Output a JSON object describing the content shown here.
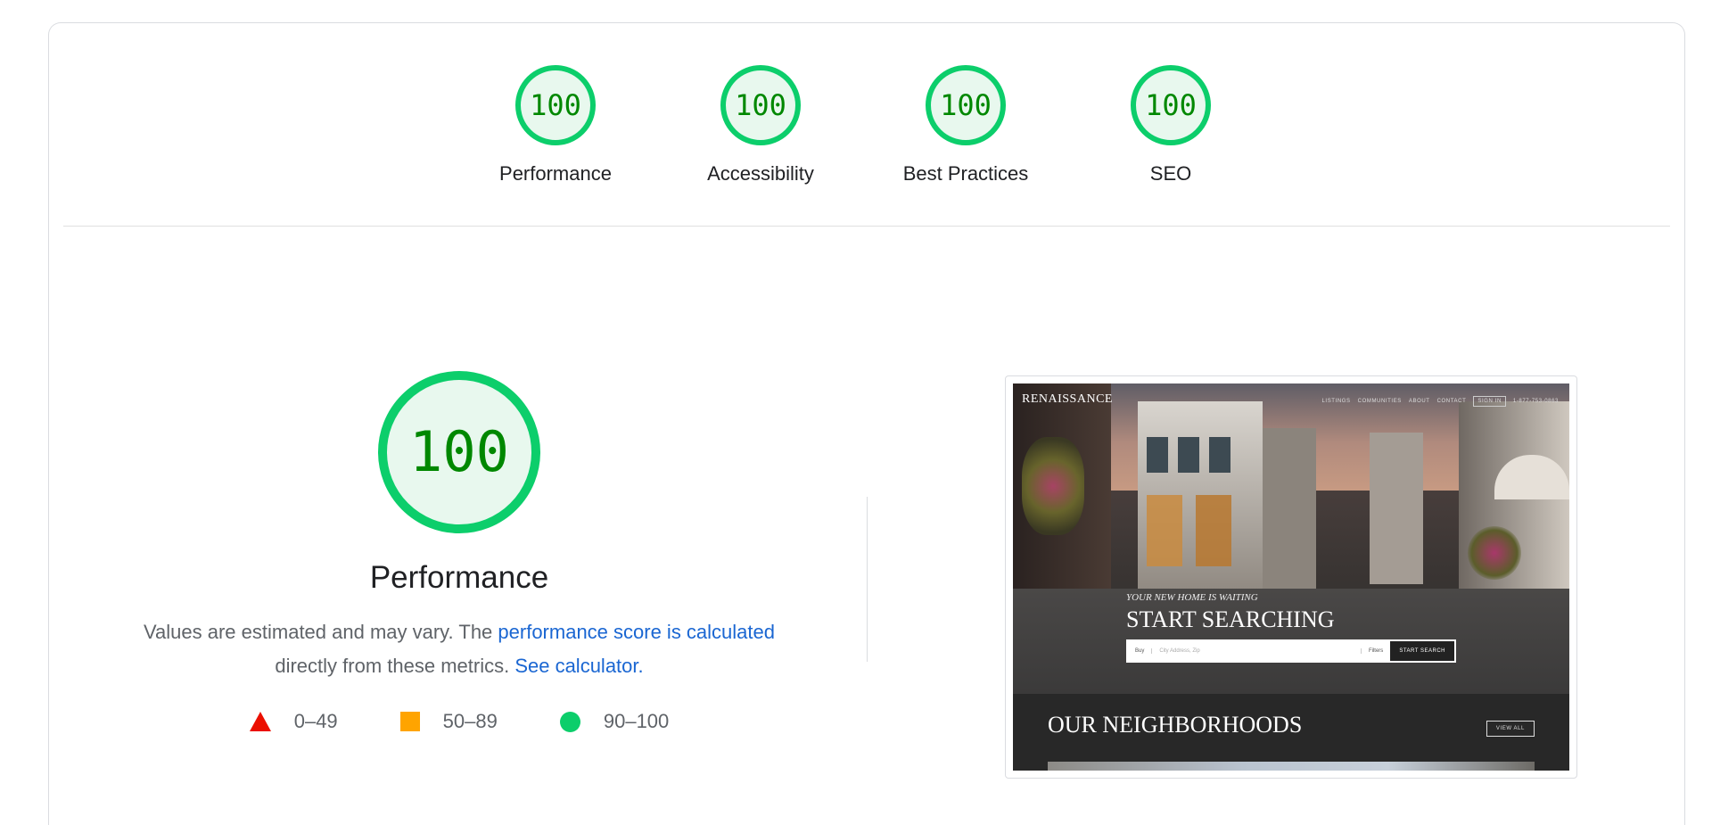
{
  "categories": [
    {
      "id": "performance",
      "score": "100",
      "label": "Performance"
    },
    {
      "id": "accessibility",
      "score": "100",
      "label": "Accessibility"
    },
    {
      "id": "best-practices",
      "score": "100",
      "label": "Best Practices"
    },
    {
      "id": "seo",
      "score": "100",
      "label": "SEO"
    }
  ],
  "performance": {
    "score": "100",
    "title": "Performance",
    "desc_prefix": "Values are estimated and may vary. The ",
    "desc_link": "performance score is calculated",
    "desc_middle": " directly from these metrics. ",
    "calc_link": "See calculator."
  },
  "legend": [
    {
      "shape": "triangle",
      "range": "0–49",
      "color": "#eb0f00"
    },
    {
      "shape": "square",
      "range": "50–89",
      "color": "#ffa400"
    },
    {
      "shape": "circle",
      "range": "90–100",
      "color": "#0cce6b"
    }
  ],
  "screenshot": {
    "brand": "RENAISSANCE",
    "nav": [
      "LISTINGS",
      "COMMUNITIES",
      "ABOUT",
      "CONTACT"
    ],
    "signin": "SIGN IN",
    "phone": "1-877-753-0863",
    "tagline": "YOUR NEW HOME IS WAITING",
    "headline": "START SEARCHING",
    "search_type": "Buy",
    "search_placeholder": "City Address, Zip",
    "filters": "Filters",
    "search_button": "START SEARCH",
    "section_title": "OUR NEIGHBORHOODS",
    "view_all": "VIEW ALL"
  },
  "colors": {
    "pass_ring": "#0cce6b",
    "pass_fill": "#e8f8ee",
    "pass_text": "#008800",
    "link": "#1a66d2"
  }
}
